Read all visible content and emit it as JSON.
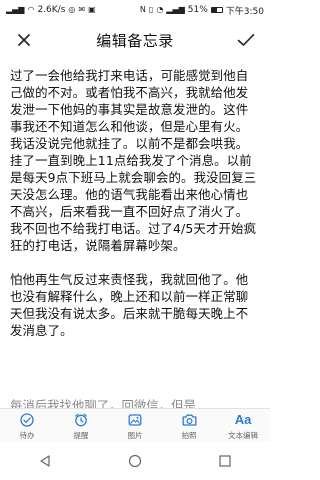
{
  "status_bar": {
    "speed": "2.6K/s",
    "battery": "51%",
    "battery_level": 0.51,
    "time": "下午3:50"
  },
  "header": {
    "title": "编辑备忘录"
  },
  "note": {
    "paragraphs": [
      "过了一会他给我打来电话，可能感觉到他自己做的不对。或者怕我不高兴，我就给他发发泄一下他妈的事其实是故意发泄的。这件事我还不知道怎么和他谈，但是心里有火。我话没说完他就挂了。以前不是都会哄我。挂了一直到晚上11点给我发了个消息。以前是每天9点下班马上就会聊会的。我没回复三天没怎么理。他的语气我能看出来他心情也不高兴，后来看我一直不回好点了消火了。我不回也不给我打电话。过了4/5天才开始疯狂的打电话，说隔着屏幕吵架。",
      "怕他再生气反过来责怪我，我就回他了。他也没有解释什么，晚上还和以前一样正常聊天但我没有说太多。后来就干脆每天晚上不发消息了。"
    ],
    "partial_line": "每消后我找他聊了，回微信，但是"
  },
  "toolbar": {
    "items": [
      {
        "label": "待办"
      },
      {
        "label": "提醒"
      },
      {
        "label": "图片"
      },
      {
        "label": "拍照"
      },
      {
        "label": "文本编辑",
        "icon_text": "Aa"
      }
    ]
  },
  "colors": {
    "accent": "#2b7bd8"
  }
}
